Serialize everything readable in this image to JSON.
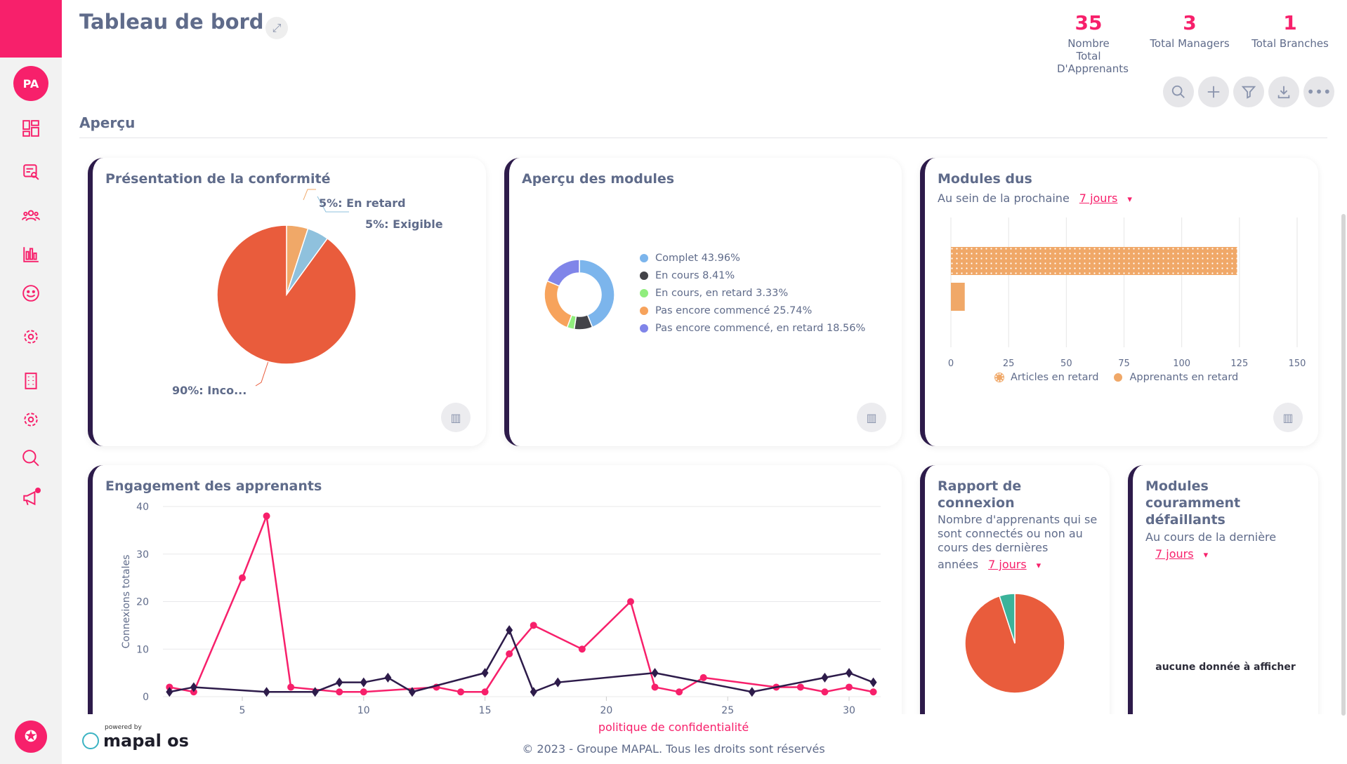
{
  "sidebar": {
    "avatar": "PA",
    "items": [
      "dashboard-icon",
      "reports-search-icon",
      "users-icon",
      "analytics-icon",
      "smiley-icon",
      "settings-icon",
      "building-icon",
      "gear-icon",
      "search-icon",
      "megaphone-icon"
    ]
  },
  "header": {
    "title": "Tableau de bord",
    "stats": [
      {
        "value": "35",
        "label": "Nombre Total D'Apprenants"
      },
      {
        "value": "3",
        "label": "Total Managers"
      },
      {
        "value": "1",
        "label": "Total Branches"
      }
    ],
    "tools": [
      "search-icon",
      "plus-icon",
      "filter-icon",
      "download-icon",
      "more-icon"
    ]
  },
  "section": "Aperçu",
  "colors": {
    "accent": "#f7206b",
    "dark": "#2d1b4a"
  },
  "compliance": {
    "title": "Présentation de la conformité",
    "labels": [
      "5%: En retard",
      "5%: Exigible",
      "90%: Inco..."
    ]
  },
  "modules": {
    "title": "Aperçu des modules",
    "legend": [
      "Complet 43.96%",
      "En cours 8.41%",
      "En cours, en retard 3.33%",
      "Pas encore commencé 25.74%",
      "Pas encore commencé, en retard 18.56%"
    ]
  },
  "due": {
    "title": "Modules dus",
    "subtitle": "Au sein de la prochaine",
    "period": "7 jours",
    "legend": [
      "Articles en retard",
      "Apprenants en retard"
    ]
  },
  "engagement": {
    "title": "Engagement des apprenants"
  },
  "connection": {
    "title": "Rapport de connexion",
    "subtitle": "Nombre d'apprenants qui se sont connectés ou non au cours des dernières",
    "subtitle_end": "années",
    "period": "7 jours"
  },
  "failing": {
    "title": "Modules couramment défaillants",
    "subtitle": "Au cours de la dernière",
    "period": "7 jours",
    "empty": "aucune donnée à afficher"
  },
  "footer": {
    "powered": "powered by",
    "logo": "mapal os",
    "privacy": "politique de confidentialité",
    "copyright": "© 2023 - Groupe MAPAL. Tous les droits sont réservés"
  },
  "chart_data": [
    {
      "type": "pie",
      "title": "Présentation de la conformité",
      "slices": [
        {
          "label": "En retard",
          "value": 5,
          "color": "#f0a868"
        },
        {
          "label": "Exigible",
          "value": 5,
          "color": "#8fc1dd"
        },
        {
          "label": "Inco...",
          "value": 90,
          "color": "#e95c3c"
        }
      ]
    },
    {
      "type": "pie",
      "title": "Aperçu des modules",
      "donut": true,
      "slices": [
        {
          "label": "Complet",
          "value": 43.96,
          "color": "#7cb5ec"
        },
        {
          "label": "En cours",
          "value": 8.41,
          "color": "#434348"
        },
        {
          "label": "En cours, en retard",
          "value": 3.33,
          "color": "#90ed7d"
        },
        {
          "label": "Pas encore commencé",
          "value": 25.74,
          "color": "#f7a35c"
        },
        {
          "label": "Pas encore commencé, en retard",
          "value": 18.56,
          "color": "#8085e9"
        }
      ]
    },
    {
      "type": "bar",
      "orientation": "horizontal",
      "title": "Modules dus",
      "series": [
        {
          "name": "Articles en retard",
          "values": [
            124
          ],
          "color": "#f0a868",
          "pattern": "dots"
        },
        {
          "name": "Apprenants en retard",
          "values": [
            6
          ],
          "color": "#f0a868"
        }
      ],
      "xlim": [
        0,
        150
      ],
      "xticks": [
        "0",
        "25",
        "50",
        "75",
        "100",
        "125",
        "150"
      ],
      "grid": true,
      "legend": "bottom"
    },
    {
      "type": "line",
      "title": "Engagement des apprenants",
      "ylabel": "Connexions totales",
      "ylim": [
        0,
        40
      ],
      "yticks": [
        "0",
        "10",
        "20",
        "30",
        "40"
      ],
      "xticks": [
        "5",
        "10",
        "15",
        "20",
        "25",
        "30"
      ],
      "grid": true,
      "series": [
        {
          "color": "#f7206b",
          "marker": "circle",
          "x": [
            2,
            3,
            5,
            6,
            7,
            9,
            10,
            13,
            14,
            15,
            16,
            17,
            19,
            21,
            22,
            23,
            24,
            27,
            28,
            29,
            30,
            31
          ],
          "y": [
            2,
            1,
            25,
            38,
            2,
            1,
            1,
            2,
            1,
            1,
            9,
            15,
            10,
            20,
            2,
            1,
            4,
            2,
            2,
            1,
            2,
            1
          ]
        },
        {
          "color": "#2d1b4a",
          "marker": "diamond",
          "x": [
            2,
            3,
            6,
            8,
            9,
            10,
            11,
            12,
            15,
            16,
            17,
            18,
            22,
            26,
            29,
            30,
            31
          ],
          "y": [
            1,
            2,
            1,
            1,
            3,
            3,
            4,
            1,
            5,
            14,
            1,
            3,
            5,
            1,
            4,
            5,
            3
          ]
        }
      ]
    },
    {
      "type": "pie",
      "title": "Rapport de connexion",
      "slices": [
        {
          "label": "",
          "value": 95,
          "color": "#e95c3c"
        },
        {
          "label": "",
          "value": 5,
          "color": "#3bb39a"
        }
      ]
    }
  ]
}
